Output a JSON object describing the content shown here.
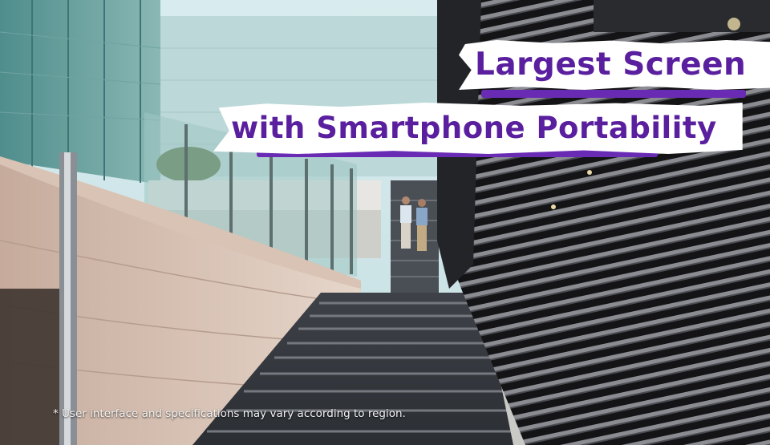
{
  "headline": {
    "line1": "Largest Screen",
    "line2": "with Smartphone Portability"
  },
  "disclaimer": "* User interface and specifications may vary according to region.",
  "colors": {
    "headline_text": "#5a1f9e",
    "headline_background": "#ffffff"
  }
}
